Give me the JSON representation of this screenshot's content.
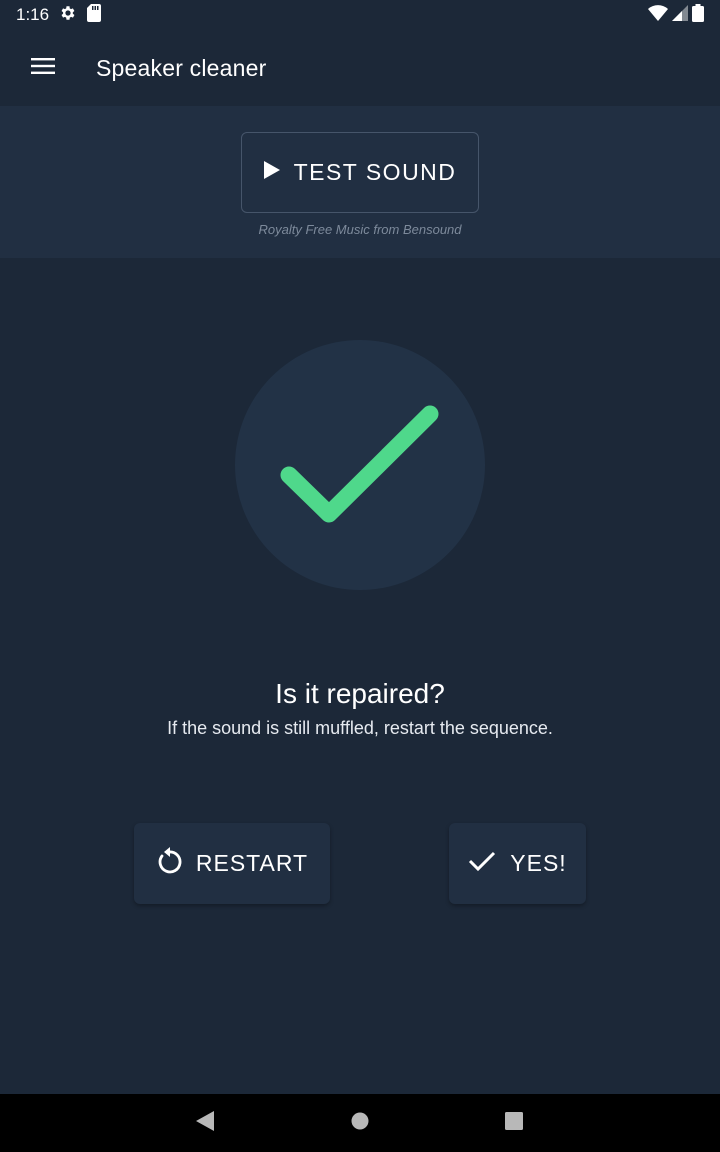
{
  "status_bar": {
    "time": "1:16",
    "icons": [
      "gear-icon",
      "sd-card-icon",
      "wifi-icon",
      "signal-icon",
      "battery-icon"
    ]
  },
  "app_bar": {
    "title": "Speaker cleaner",
    "menu_icon": "hamburger-menu-icon"
  },
  "test_panel": {
    "button_label": "TEST SOUND",
    "button_icon": "play-icon",
    "credit": "Royalty Free Music from Bensound"
  },
  "result": {
    "icon": "checkmark-icon",
    "accent_color": "#4fd88b",
    "question": "Is it repaired?",
    "hint": "If the sound is still muffled, restart the sequence."
  },
  "actions": {
    "restart_label": "RESTART",
    "restart_icon": "restart-icon",
    "yes_label": "YES!",
    "yes_icon": "check-icon"
  },
  "nav_bar": {
    "icons": [
      "back-icon",
      "home-icon",
      "recents-icon"
    ]
  },
  "colors": {
    "background": "#1c2838",
    "panel": "#212f42",
    "circle": "#223246",
    "accent": "#4fd88b"
  }
}
